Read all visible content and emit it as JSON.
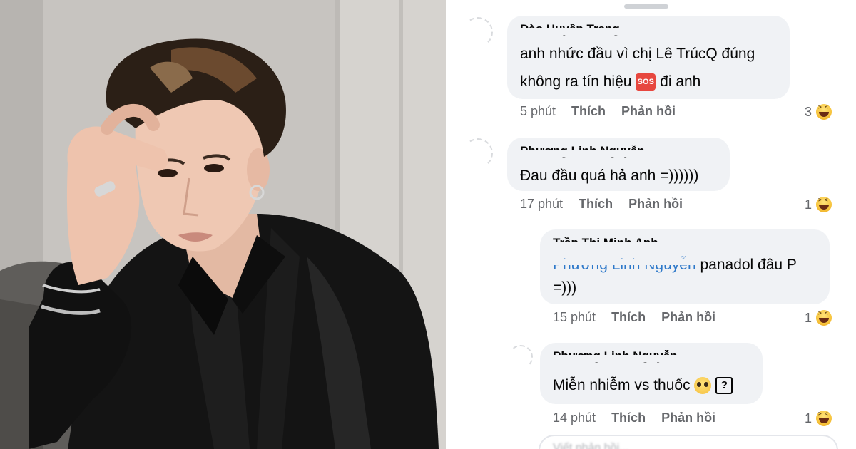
{
  "comments": [
    {
      "author": "Đào Huyền Trang",
      "text_lines": [
        "anh nhức đầu vì chị Lê TrúcQ đúng",
        "không ra tín hiệu"
      ],
      "text_tail": "đi anh",
      "emoji_icon": "sos-icon",
      "time": "5 phút",
      "like": "Thích",
      "reply": "Phản hồi",
      "reaction_count": "3",
      "reaction_icon": "haha-icon"
    },
    {
      "author": "Phương Linh Nguyễn",
      "text_lines": [
        "Đau đầu quá hả anh =))))))"
      ],
      "time": "17 phút",
      "like": "Thích",
      "reply": "Phản hồi",
      "reaction_count": "1",
      "reaction_icon": "haha-icon"
    },
    {
      "author": "Trần Thị Minh Anh",
      "mention": "Phương Linh Nguyễn",
      "text_after_mention": "panadol đâu P",
      "text_line2": "=)))",
      "time": "15 phút",
      "like": "Thích",
      "reply": "Phản hồi",
      "reaction_count": "1",
      "reaction_icon": "haha-icon"
    },
    {
      "author": "Phương Linh Nguyễn",
      "text_lines": [
        "Miễn nhiễm vs thuốc"
      ],
      "emoji_icon": "pleading-face-icon",
      "unknown_glyph": "?",
      "time": "14 phút",
      "like": "Thích",
      "reply": "Phản hồi",
      "reaction_count": "1",
      "reaction_icon": "haha-icon"
    }
  ],
  "composer": {
    "placeholder": "Viết phản hồi..."
  },
  "colors": {
    "bubble": "#f0f2f5",
    "meta_text": "#65676b",
    "mention": "#2d78c9",
    "sos_badge": "#e7473f"
  }
}
